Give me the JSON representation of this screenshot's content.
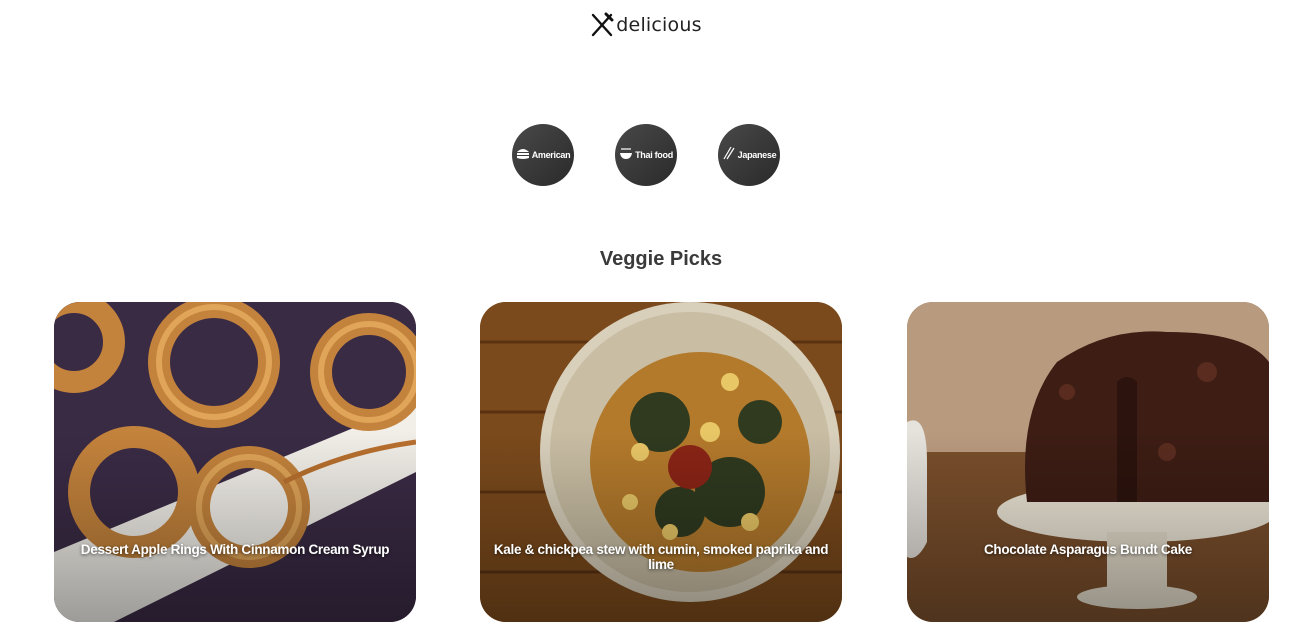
{
  "header": {
    "logo_text": "delicious",
    "logo_icon": "fork-knife-icon"
  },
  "cuisines": [
    {
      "label": "American",
      "icon": "burger-icon"
    },
    {
      "label": "Thai food",
      "icon": "noodle-bowl-icon"
    },
    {
      "label": "Japanese",
      "icon": "chopsticks-icon"
    }
  ],
  "section": {
    "title": "Veggie Picks"
  },
  "cards": [
    {
      "title": "Dessert Apple Rings With Cinnamon Cream Syrup"
    },
    {
      "title": "Kale & chickpea stew with cumin, smoked paprika and lime"
    },
    {
      "title": "Chocolate Asparagus Bundt Cake"
    }
  ]
}
